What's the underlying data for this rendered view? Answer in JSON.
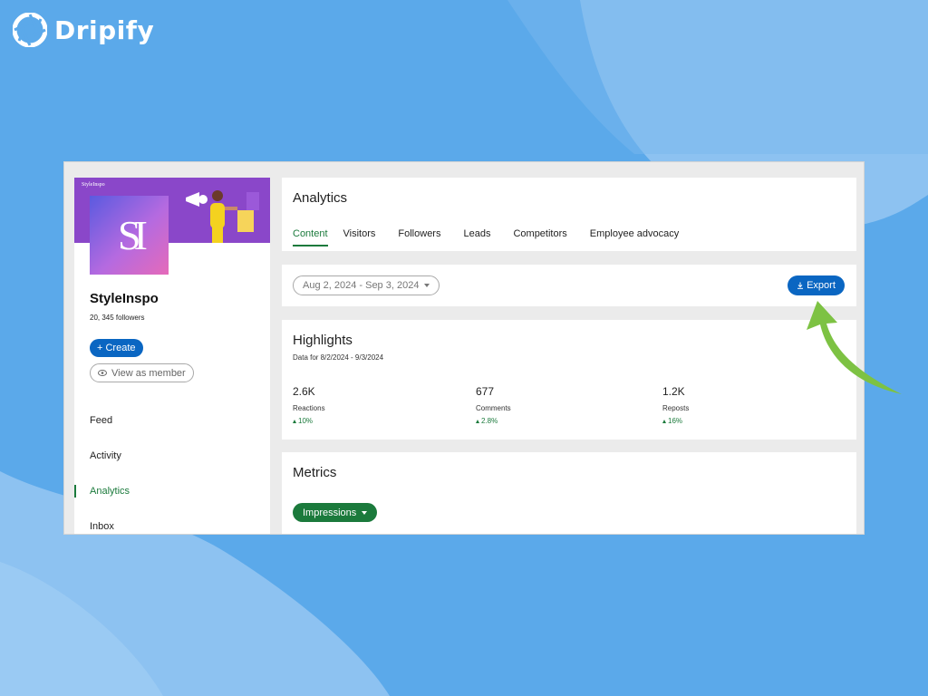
{
  "brand": {
    "name": "Dripify",
    "logo_icon": "shutter-logo-icon",
    "color": "#ffffff"
  },
  "background_color": "#5ba9ea",
  "profile": {
    "cover_brand": "StyleInspo",
    "logo_text": "SI",
    "name": "StyleInspo",
    "followers": "20, 345 followers",
    "create_label": "+ Create",
    "view_as_member_label": "View as member"
  },
  "nav": {
    "items": [
      {
        "label": "Feed",
        "active": false
      },
      {
        "label": "Activity",
        "active": false
      },
      {
        "label": "Analytics",
        "active": true
      },
      {
        "label": "Inbox",
        "active": false
      }
    ]
  },
  "analytics": {
    "title": "Analytics",
    "tabs": [
      {
        "label": "Content",
        "active": true
      },
      {
        "label": "Visitors",
        "active": false
      },
      {
        "label": "Followers",
        "active": false
      },
      {
        "label": "Leads",
        "active": false
      },
      {
        "label": "Competitors",
        "active": false
      },
      {
        "label": "Employee advocacy",
        "active": false
      }
    ]
  },
  "date_range": {
    "label": "Aug 2, 2024 - Sep 3, 2024"
  },
  "export": {
    "label": "Export"
  },
  "highlights": {
    "title": "Highlights",
    "subtitle": "Data for 8/2/2024 - 9/3/2024",
    "metrics": [
      {
        "value": "2.6K",
        "label": "Reactions",
        "change": "10%"
      },
      {
        "value": "677",
        "label": "Comments",
        "change": "2.8%"
      },
      {
        "value": "1.2K",
        "label": "Reposts",
        "change": "16%"
      }
    ]
  },
  "metrics": {
    "title": "Metrics",
    "dropdown_label": "Impressions"
  },
  "colors": {
    "primary_blue": "#0a66c2",
    "active_green": "#1b7a3c",
    "arrow_green": "#7dc243",
    "cover_purple": "#8a47c9"
  }
}
